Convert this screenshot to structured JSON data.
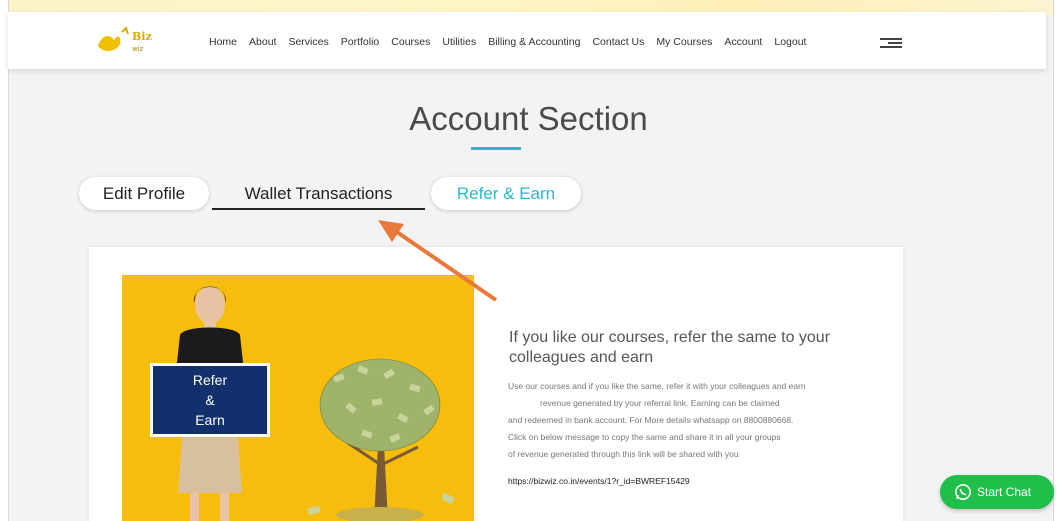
{
  "nav": {
    "items": [
      "Home",
      "About",
      "Services",
      "Portfolio",
      "Courses",
      "Utilities",
      "Billing & Accounting",
      "Contact Us",
      "My Courses",
      "Account",
      "Logout"
    ]
  },
  "page": {
    "title": "Account Section"
  },
  "tabs": {
    "edit_profile": "Edit Profile",
    "wallet_transactions": "Wallet Transactions",
    "refer_earn": "Refer & Earn"
  },
  "promo": {
    "sign_line1": "Refer",
    "sign_line2": "&",
    "sign_line3": "Earn"
  },
  "content": {
    "heading": "If you like our courses, refer the same to your colleagues and earn",
    "desc_line1": "Use our courses and if you like the same, refer it with your colleagues and earn",
    "desc_line2": "revenue generated by your referral link. Earning can be claimed",
    "desc_line3": "and redeemed in bank account. For More details whatsapp on 8800880668.",
    "desc_line4": "Click on below message to copy the same and share it in all your groups",
    "desc_line5": "of revenue generated through this link will be shared with you",
    "referral_link": "https://bizwiz.co.in/events/1?r_id=BWREF15429"
  },
  "chat": {
    "label": "Start Chat"
  },
  "colors": {
    "accent": "#29b8cb",
    "promo_bg": "#f7bd0d",
    "chat_green": "#1fbf4a",
    "arrow": "#e8793a"
  },
  "icons": [
    "logo-icon",
    "hamburger-menu-icon",
    "whatsapp-icon",
    "arrow-annotation"
  ]
}
